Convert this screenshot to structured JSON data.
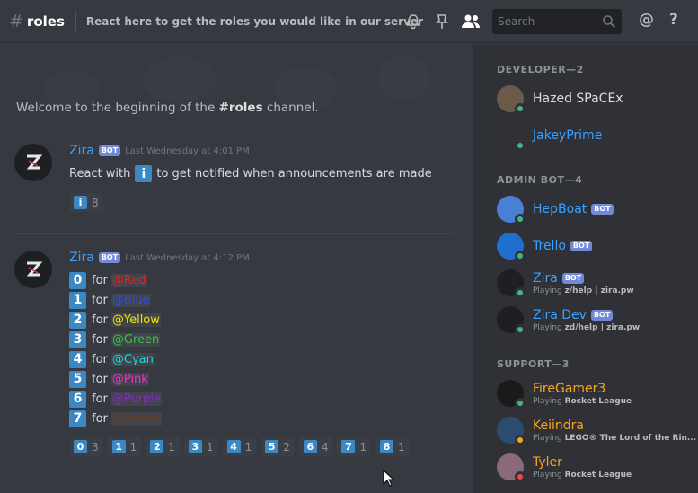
{
  "header": {
    "hash": "#",
    "channel": "roles",
    "topic": "React here to get the roles you would like in our server",
    "search_placeholder": "Search",
    "at": "@",
    "help": "?"
  },
  "chat": {
    "welcome_prefix": "Welcome to the beginning of the ",
    "welcome_channel": "#roles",
    "welcome_suffix": " channel.",
    "messages": [
      {
        "author": "Zira",
        "bot": "BOT",
        "timestamp": "Last Wednesday at 4:01 PM",
        "text_before": "React with",
        "emoji": "i",
        "text_after": "to get notified when announcements are made",
        "reactions": [
          {
            "emoji": "i",
            "count": "8"
          }
        ]
      },
      {
        "author": "Zira",
        "bot": "BOT",
        "timestamp": "Last Wednesday at 4:12 PM",
        "lines": [
          {
            "key": "0",
            "for": "for",
            "role": "@Red",
            "color": "#e91e1e"
          },
          {
            "key": "1",
            "for": "for",
            "role": "@Blue",
            "color": "#2d4fe0"
          },
          {
            "key": "2",
            "for": "for",
            "role": "@Yellow",
            "color": "#f1e40f"
          },
          {
            "key": "3",
            "for": "for",
            "role": "@Green",
            "color": "#2ecc40"
          },
          {
            "key": "4",
            "for": "for",
            "role": "@Cyan",
            "color": "#1fd3e6"
          },
          {
            "key": "5",
            "for": "for",
            "role": "@Pink",
            "color": "#f22fd0"
          },
          {
            "key": "6",
            "for": "for",
            "role": "@Purple",
            "color": "#8e24d6"
          },
          {
            "key": "7",
            "for": "for",
            "role": "@Brown",
            "color": "#6b3b1c"
          }
        ],
        "reactions": [
          {
            "emoji": "0",
            "count": "3"
          },
          {
            "emoji": "1",
            "count": "1"
          },
          {
            "emoji": "2",
            "count": "1"
          },
          {
            "emoji": "3",
            "count": "1"
          },
          {
            "emoji": "4",
            "count": "1"
          },
          {
            "emoji": "5",
            "count": "2"
          },
          {
            "emoji": "6",
            "count": "4"
          },
          {
            "emoji": "7",
            "count": "1"
          },
          {
            "emoji": "8",
            "count": "1"
          }
        ]
      }
    ]
  },
  "members": {
    "groups": [
      {
        "title": "DEVELOPER—2",
        "members": [
          {
            "name": "Hazed SPaCEx",
            "color": "#dcddde",
            "status": "online",
            "avatar": "#6b5a4a"
          },
          {
            "name": "JakeyPrime",
            "color": "#3aa1ff",
            "status": "online",
            "avatar": "#2f3136"
          }
        ]
      },
      {
        "title": "ADMIN BOT—4",
        "members": [
          {
            "name": "HepBoat",
            "color": "#3aa1ff",
            "bot": "BOT",
            "status": "online",
            "avatar": "#4a7fd6"
          },
          {
            "name": "Trello",
            "color": "#3aa1ff",
            "bot": "BOT",
            "status": "online",
            "avatar": "#1f6fd1"
          },
          {
            "name": "Zira",
            "color": "#3aa1ff",
            "bot": "BOT",
            "status": "online",
            "avatar": "#1e1f23",
            "playing": "Playing",
            "game": "z/help | zira.pw"
          },
          {
            "name": "Zira Dev",
            "color": "#3aa1ff",
            "bot": "BOT",
            "status": "online",
            "avatar": "#1e1f23",
            "playing": "Playing",
            "game": "zd/help | zira.pw"
          }
        ]
      },
      {
        "title": "SUPPORT—3",
        "members": [
          {
            "name": "FireGamer3",
            "color": "#faa61a",
            "status": "online",
            "avatar": "#1a1a1a",
            "playing": "Playing",
            "game": "Rocket League"
          },
          {
            "name": "Keiindra",
            "color": "#faa61a",
            "status": "idle",
            "avatar": "#2b4c6e",
            "playing": "Playing",
            "game": "LEGO® The Lord of the Rin..."
          },
          {
            "name": "Tyler",
            "color": "#faa61a",
            "status": "dnd",
            "avatar": "#8a6a7a",
            "playing": "Playing",
            "game": "Rocket League"
          }
        ]
      }
    ]
  }
}
